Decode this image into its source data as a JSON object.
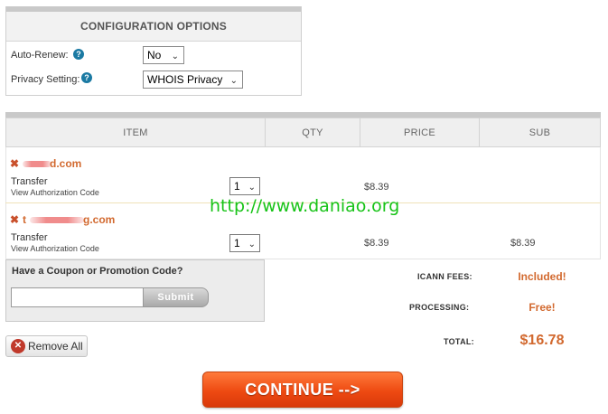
{
  "config": {
    "header": "CONFIGURATION OPTIONS",
    "auto_renew": {
      "label": "Auto-Renew:",
      "help_icon": "question-circle-icon",
      "value": "No"
    },
    "privacy": {
      "label": "Privacy Setting:",
      "help_icon": "question-circle-icon",
      "value": "WHOIS Privacy"
    }
  },
  "cart": {
    "columns": [
      "ITEM",
      "QTY",
      "PRICE",
      "SUB"
    ],
    "items": [
      {
        "remove_icon": "x-icon",
        "domain_suffix": "d.com",
        "type": "Transfer",
        "link": "View Authorization Code",
        "qty": "1",
        "price": "$8.39",
        "sub": ""
      },
      {
        "remove_icon": "x-icon",
        "domain_prefix": "t",
        "domain_suffix": "g.com",
        "type": "Transfer",
        "link": "View Authorization Code",
        "qty": "1",
        "price": "$8.39",
        "sub": "$8.39"
      }
    ]
  },
  "watermark": "http://www.daniao.org",
  "coupon": {
    "title": "Have a Coupon or Promotion Code?",
    "input_value": "",
    "submit_label": "Submit"
  },
  "totals": {
    "icann_label": "ICANN FEES:",
    "icann_value": "Included!",
    "processing_label": "PROCESSING:",
    "processing_value": "Free!",
    "total_label": "TOTAL:",
    "total_value": "$16.78"
  },
  "remove_all_label": "Remove All",
  "continue_label": "CONTINUE -->",
  "colors": {
    "accent_orange": "#d2692f",
    "continue_button": "#ee4a12",
    "help_icon": "#1b7aa3",
    "watermark": "#17c317"
  }
}
